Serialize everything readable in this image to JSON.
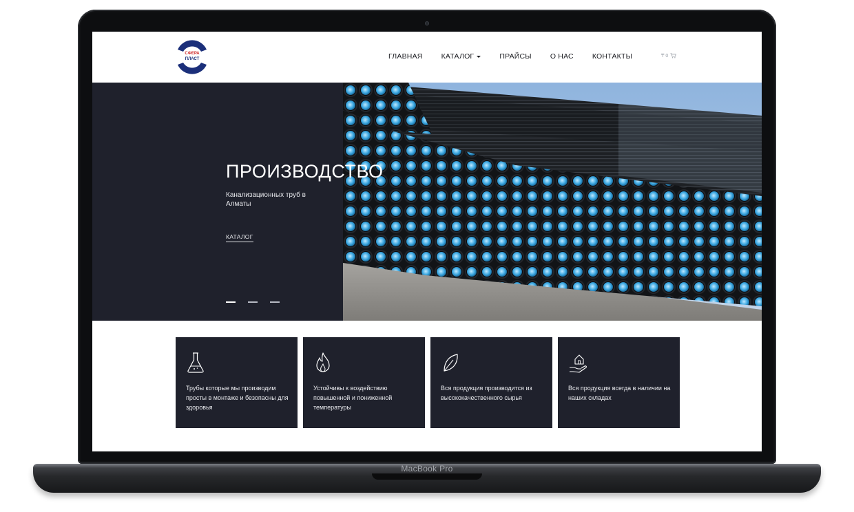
{
  "device": {
    "label": "MacBook Pro"
  },
  "site": {
    "logo": {
      "line1": "СФЕРА",
      "line2": "ПЛАСТ",
      "accent_color": "#cf2a2a",
      "ring_color": "#1b2f7a"
    },
    "nav": {
      "items": [
        {
          "label": "ГЛАВНАЯ",
          "has_dropdown": false
        },
        {
          "label": "КАТАЛОГ",
          "has_dropdown": true
        },
        {
          "label": "ПРАЙСЫ",
          "has_dropdown": false
        },
        {
          "label": "О НАС",
          "has_dropdown": false
        },
        {
          "label": "КОНТАКТЫ",
          "has_dropdown": false
        }
      ]
    },
    "cart": {
      "amount": "₸ 0",
      "icon": "cart-icon"
    }
  },
  "hero": {
    "title": "ПРОИЗВОДСТВО",
    "subtitle": "Канализационных труб в Алматы",
    "link_label": "КАТАЛОГ",
    "slides_count": 3,
    "active_slide": 1,
    "panel_color": "#1f212c"
  },
  "features": [
    {
      "icon": "flask-icon",
      "text": "Трубы которые мы производим просты в монтаже и безопасны для здоровья"
    },
    {
      "icon": "flame-icon",
      "text": "Устойчивы к воздействию повышенной и пониженной температуры"
    },
    {
      "icon": "leaf-icon",
      "text": "Вся продукция производится из высококачественного сырья"
    },
    {
      "icon": "house-hand-icon",
      "text": "Вся продукция всегда в наличии на наших складах"
    }
  ]
}
